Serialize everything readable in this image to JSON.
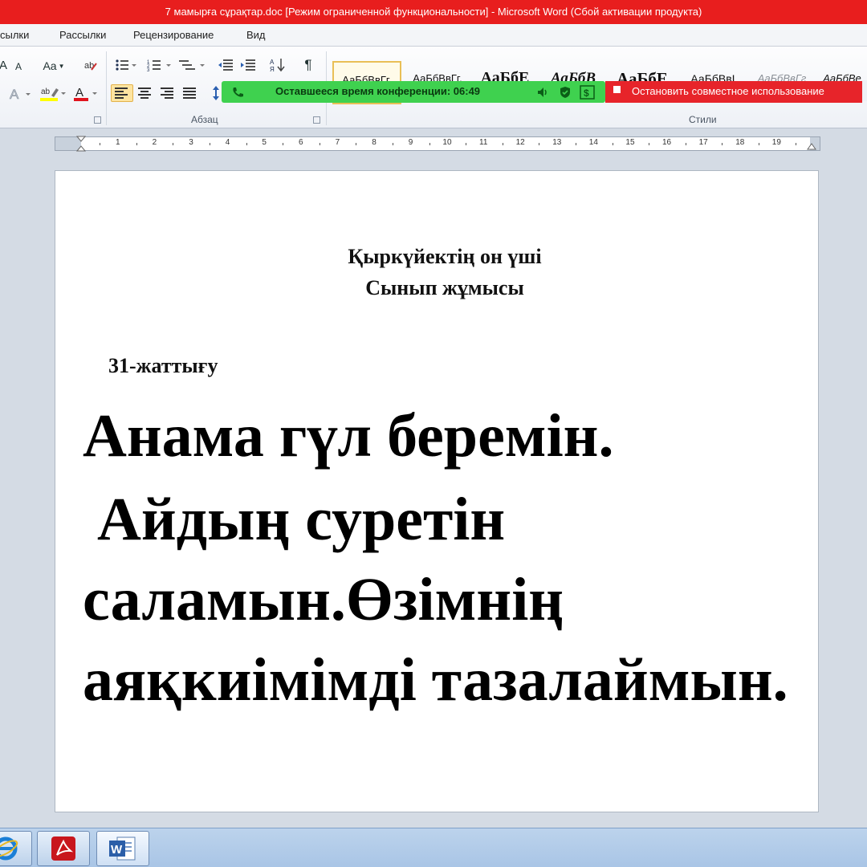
{
  "window": {
    "title": "7 мамырға сұрақтар.doc [Режим ограниченной функциональности]  -  Microsoft Word (Сбой активации продукта)"
  },
  "menu": {
    "tabs": [
      "сылки",
      "Рассылки",
      "Рецензирование",
      "Вид"
    ]
  },
  "ribbon": {
    "font_grow_label": "A",
    "font_shrink_label": "A",
    "change_case_label": "Aa",
    "paragraph_mark": "¶",
    "groups": {
      "paragraph": "Абзац",
      "styles": "Стили"
    },
    "styles": [
      {
        "label": "АаБбВвГг,",
        "selected": true
      },
      {
        "label": "АаБбВвГг,"
      },
      {
        "label": "АаБбЕ"
      },
      {
        "label": "АаБбВ"
      },
      {
        "label": "АаБбЕ"
      },
      {
        "label": "АаБбВвI"
      },
      {
        "label": "АаБбВвГг"
      },
      {
        "label": "АаБбВе"
      }
    ]
  },
  "conference": {
    "time_remaining": "Оставшееся время конференции: 06:49",
    "stop_sharing": "Остановить совместное использование",
    "colors": {
      "bar": "#3fd14f",
      "stop": "#e7242a"
    }
  },
  "ruler": {
    "numbers": [
      "1",
      "2",
      "3",
      "4",
      "5",
      "6",
      "7",
      "8",
      "9",
      "10",
      "11",
      "12",
      "13",
      "14",
      "15",
      "16",
      "17",
      "18",
      "19"
    ]
  },
  "document": {
    "title": "Қыркүйектің он үші",
    "subtitle": "Сынып жұмысы",
    "exercise": "31-жаттығу",
    "lines": [
      "Анама гүл беремін.",
      "Айдың суретін",
      "саламын.Өзімнің",
      "аяқкиімімді тазалаймын."
    ]
  },
  "taskbar": {
    "apps": [
      "ie-icon",
      "acrobat-icon",
      "word-icon"
    ]
  },
  "colors": {
    "titlebar": "#e81e1e",
    "highlight": "#ffff00",
    "font_color": "#e0141e"
  }
}
